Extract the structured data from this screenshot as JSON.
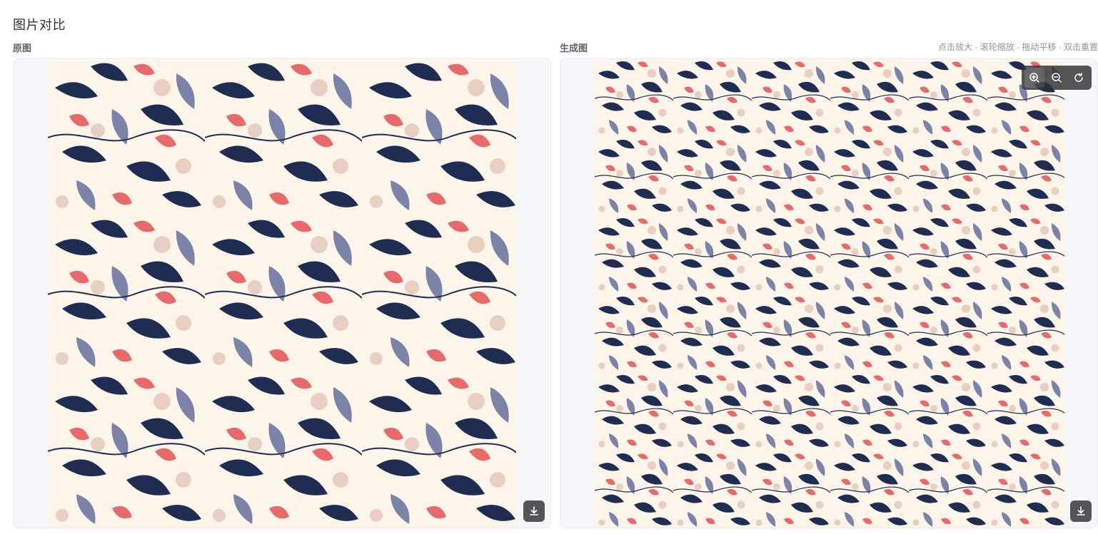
{
  "page": {
    "title": "图片对比"
  },
  "original": {
    "label": "原图",
    "download_icon": "download-icon"
  },
  "generated": {
    "label": "生成图",
    "hint": "点击放大 · 滚轮缩放 · 拖动平移 · 双击重置",
    "toolbar": {
      "zoom_in_icon": "zoom-in-icon",
      "zoom_out_icon": "zoom-out-icon",
      "reset_icon": "reset-icon"
    },
    "download_icon": "download-icon"
  },
  "colors": {
    "background": "#fdf5ea",
    "navy": "#1f2d52",
    "slate": "#7b83a9",
    "coral": "#e8696a",
    "blush": "#e9cfc2"
  }
}
